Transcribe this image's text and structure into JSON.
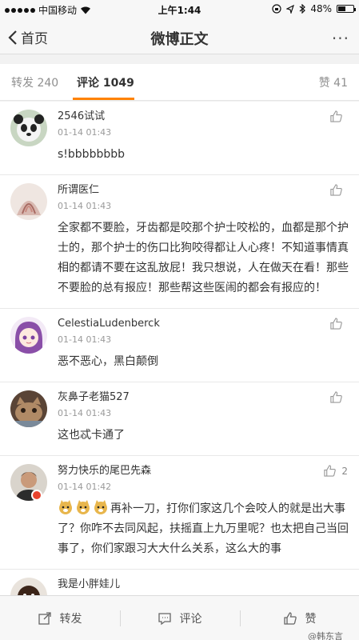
{
  "status_bar": {
    "carrier": "中国移动",
    "time": "上午1:44",
    "battery": "48%"
  },
  "nav": {
    "back_label": "首页",
    "title": "微博正文",
    "more": "···"
  },
  "tabs": {
    "repost": "转发 240",
    "comment": "评论 1049",
    "like": "赞 41"
  },
  "comments": [
    {
      "name": "2546试试",
      "time": "01-14 01:43",
      "text": "s!bbbbbbbb",
      "likes": ""
    },
    {
      "name": "所谓医仁",
      "time": "01-14 01:43",
      "text": "全家都不要脸，牙齿都是咬那个护士咬松的，血都是那个护士的，那个护士的伤口比狗咬得都让人心疼！不知道事情真相的都请不要在这乱放屁！我只想说，人在做天在看！那些不要脸的总有报应！那些帮这些医闹的都会有报应的！",
      "likes": ""
    },
    {
      "name": "CelestiaLudenberck",
      "time": "01-14 01:43",
      "text": "恶不恶心，黑白颠倒",
      "likes": ""
    },
    {
      "name": "灰鼻子老猫527",
      "time": "01-14 01:43",
      "text": "这也忒卡通了",
      "likes": ""
    },
    {
      "name": "努力快乐的尾巴先森",
      "time": "01-14 01:42",
      "text": "再补一刀，打你们家这几个会咬人的就是出大事了？你咋不去同风起，扶摇直上九万里呢？也太把自己当回事了，你们家跟习大大什么关系，这么大的事",
      "likes": "2"
    },
    {
      "name": "我是小胖娃儿",
      "time": "",
      "text": "",
      "likes": ""
    }
  ],
  "bottom_bar": {
    "repost": "转发",
    "comment": "评论",
    "like": "赞"
  },
  "watermark": "@韩东言",
  "colors": {
    "accent": "#ff8200",
    "text": "#333333",
    "muted": "#9a9a9a"
  }
}
